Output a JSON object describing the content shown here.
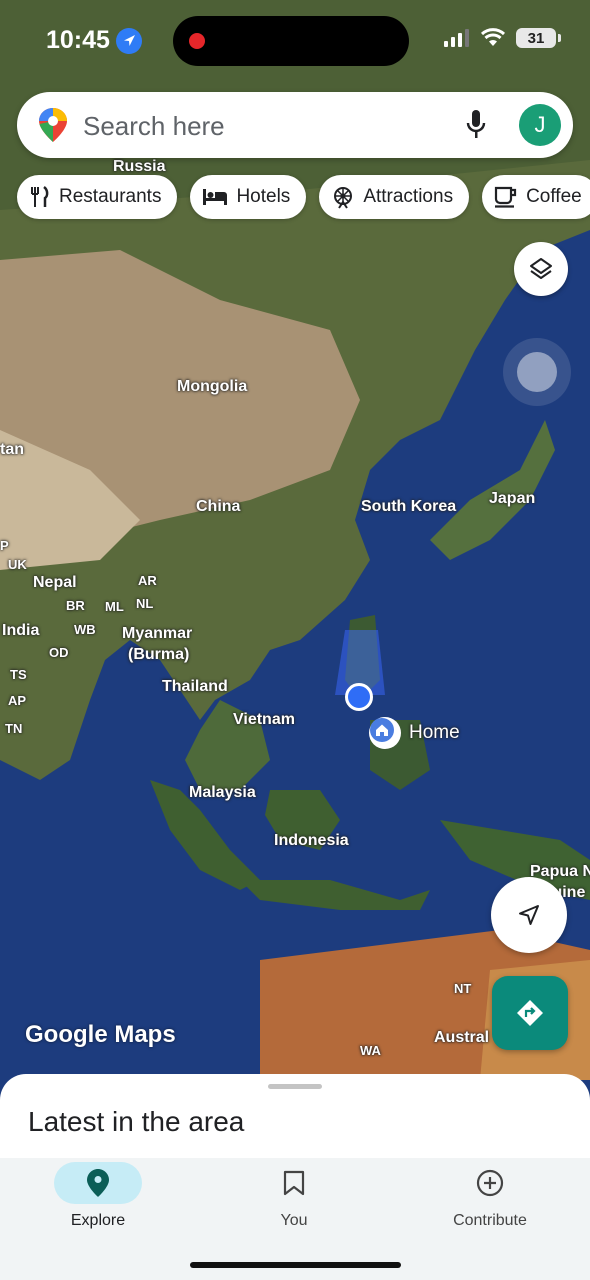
{
  "status_bar": {
    "time": "10:45",
    "battery": "31"
  },
  "search": {
    "placeholder": "Search here",
    "avatar_initial": "J"
  },
  "chips": [
    {
      "label": "Restaurants",
      "icon": "restaurant-icon"
    },
    {
      "label": "Hotels",
      "icon": "hotel-icon"
    },
    {
      "label": "Attractions",
      "icon": "attraction-icon"
    },
    {
      "label": "Coffee",
      "icon": "coffee-icon"
    }
  ],
  "map": {
    "labels": {
      "russia": "Russia",
      "mongolia": "Mongolia",
      "china": "China",
      "south_korea": "South Korea",
      "japan": "Japan",
      "kazakhstan_partial": "tan",
      "nepal": "Nepal",
      "india": "India",
      "myanmar_1": "Myanmar",
      "myanmar_2": "(Burma)",
      "thailand": "Thailand",
      "vietnam": "Vietnam",
      "malaysia": "Malaysia",
      "indonesia": "Indonesia",
      "papua_1": "Papua N",
      "papua_2": "Guine",
      "australia": "Austral",
      "nt": "NT",
      "wa": "WA",
      "uk": "UK",
      "ar": "AR",
      "br": "BR",
      "ml": "ML",
      "nl": "NL",
      "wb": "WB",
      "od": "OD",
      "ts": "TS",
      "ap": "AP",
      "tn": "TN",
      "p": "P",
      "home": "Home"
    },
    "watermark": "Google Maps"
  },
  "sheet": {
    "title": "Latest in the area"
  },
  "tabs": [
    {
      "label": "Explore",
      "active": true
    },
    {
      "label": "You",
      "active": false
    },
    {
      "label": "Contribute",
      "active": false
    }
  ],
  "colors": {
    "accent": "#0b8a7b",
    "active_tab_bg": "#c6ecf6",
    "location_blue": "#2f6df6"
  }
}
